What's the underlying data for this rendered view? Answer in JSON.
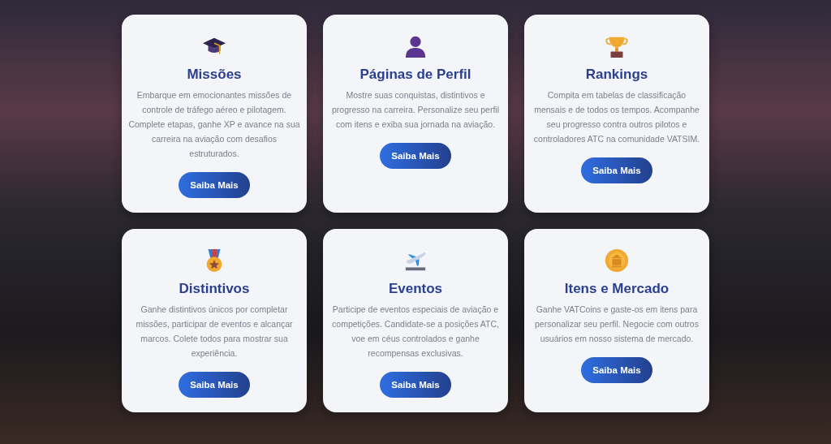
{
  "cards": [
    {
      "title": "Missões",
      "text": "Embarque em emocionantes missões de controle de tráfego aéreo e pilotagem. Complete etapas, ganhe XP e avance na sua carreira na aviação com desafios estruturados.",
      "button": "Saiba Mais"
    },
    {
      "title": "Páginas de Perfil",
      "text": "Mostre suas conquistas, distintivos e progresso na carreira. Personalize seu perfil com itens e exiba sua jornada na aviação.",
      "button": "Saiba Mais"
    },
    {
      "title": "Rankings",
      "text": "Compita em tabelas de classificação mensais e de todos os tempos. Acompanhe seu progresso contra outros pilotos e controladores ATC na comunidade VATSIM.",
      "button": "Saiba Mais"
    },
    {
      "title": "Distintivos",
      "text": "Ganhe distintivos únicos por completar missões, participar de eventos e alcançar marcos. Colete todos para mostrar sua experiência.",
      "button": "Saiba Mais"
    },
    {
      "title": "Eventos",
      "text": "Participe de eventos especiais de aviação e competições. Candidate-se a posições ATC, voe em céus controlados e ganhe recompensas exclusivas.",
      "button": "Saiba Mais"
    },
    {
      "title": "Itens e Mercado",
      "text": "Ganhe VATCoins e gaste-os em itens para personalizar seu perfil. Negocie com outros usuários em nosso sistema de mercado.",
      "button": "Saiba Mais"
    }
  ]
}
